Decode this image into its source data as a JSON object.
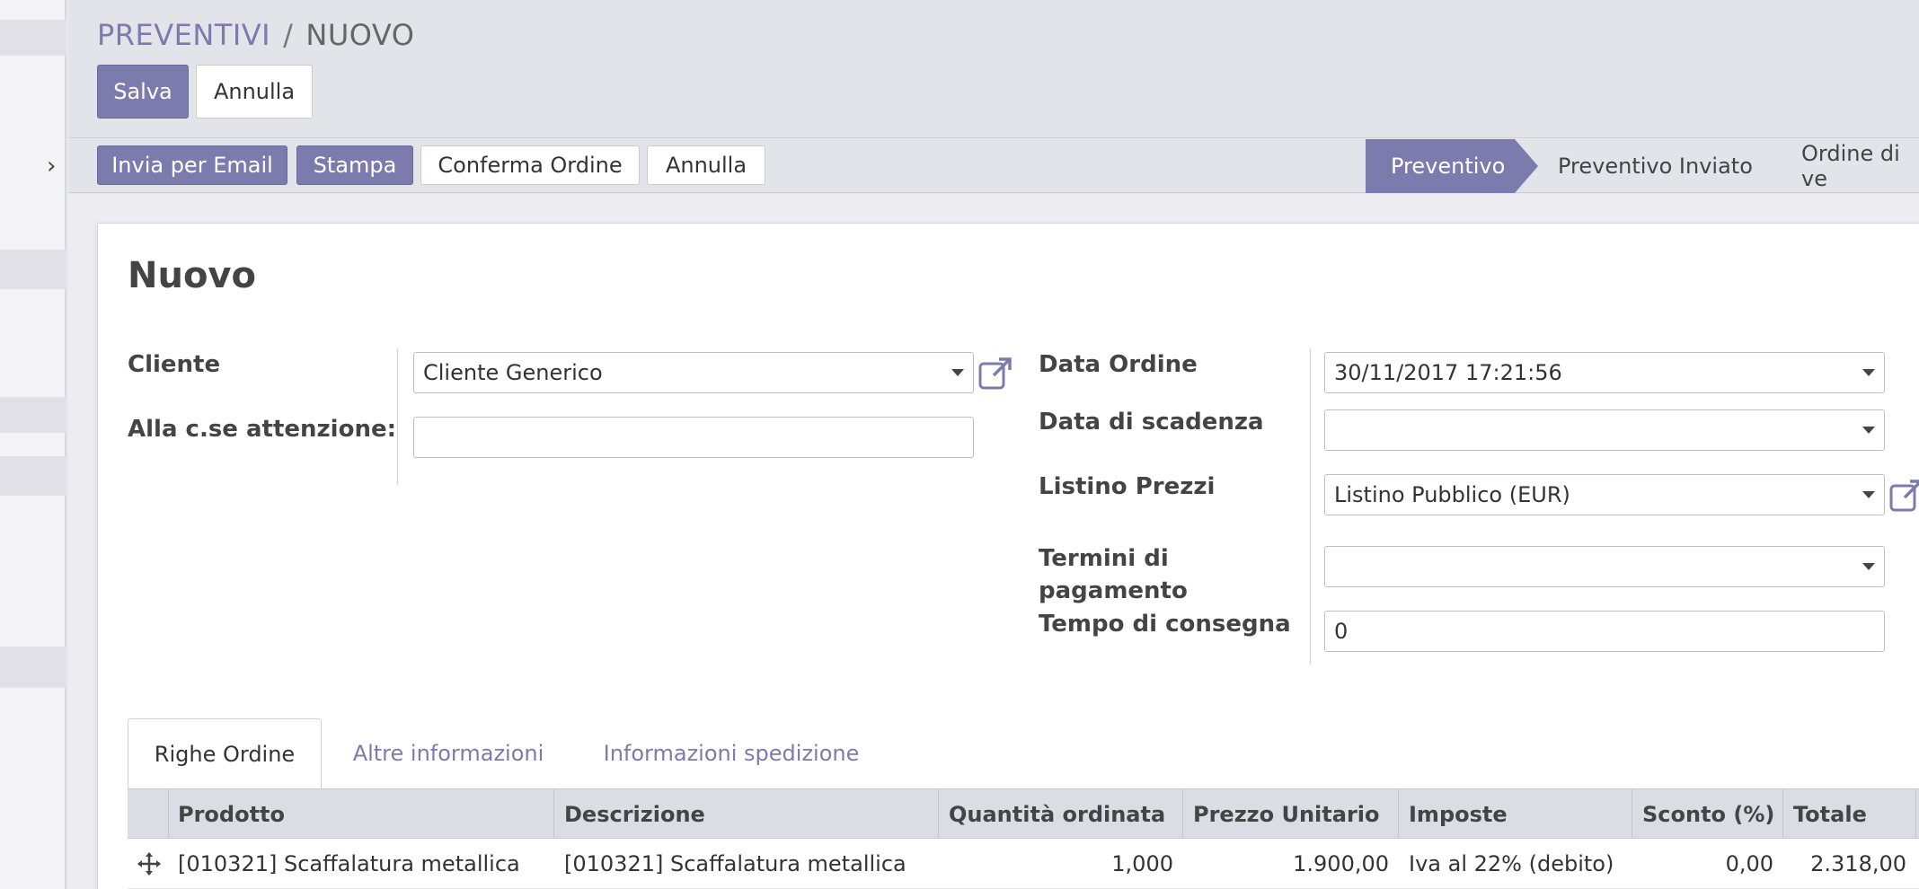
{
  "breadcrumb": {
    "parent": "PREVENTIVI",
    "separator": "/",
    "current": "NUOVO"
  },
  "control_buttons": {
    "save": "Salva",
    "discard": "Annulla"
  },
  "header_buttons": {
    "send_email": "Invia per Email",
    "print": "Stampa",
    "confirm": "Conferma Ordine",
    "cancel": "Annulla"
  },
  "status_stages": [
    {
      "label": "Preventivo",
      "active": true
    },
    {
      "label": "Preventivo Inviato",
      "active": false
    },
    {
      "label": "Ordine di ve",
      "active": false
    }
  ],
  "record": {
    "title": "Nuovo"
  },
  "left_fields": {
    "customer_label": "Cliente",
    "customer_value": "Cliente Generico",
    "attention_label": "Alla c.se attenzione:",
    "attention_value": ""
  },
  "right_fields": {
    "order_date_label": "Data Ordine",
    "order_date_value": "30/11/2017 17:21:56",
    "expiry_label": "Data di scadenza",
    "expiry_value": "",
    "pricelist_label": "Listino Prezzi",
    "pricelist_value": "Listino Pubblico (EUR)",
    "payment_terms_label_1": "Termini di",
    "payment_terms_label_2": "pagamento",
    "payment_terms_value": "",
    "delivery_label": "Tempo di consegna",
    "delivery_value": "0"
  },
  "tabs": [
    {
      "label": "Righe Ordine",
      "active": true
    },
    {
      "label": "Altre informazioni",
      "active": false
    },
    {
      "label": "Informazioni spedizione",
      "active": false
    }
  ],
  "table": {
    "columns": [
      "Prodotto",
      "Descrizione",
      "Quantità ordinata",
      "Prezzo Unitario",
      "Imposte",
      "Sconto (%)",
      "Totale"
    ],
    "rows": [
      [
        "[010321] Scaffalatura metallica",
        "[010321] Scaffalatura metallica",
        "1,000",
        "1.900,00",
        "Iva al 22% (debito)",
        "0,00",
        "2.318,00"
      ]
    ]
  },
  "colors": {
    "accent": "#7c7bad",
    "header_bg": "#e3e3ea",
    "table_header_bg": "#dcdce4"
  }
}
